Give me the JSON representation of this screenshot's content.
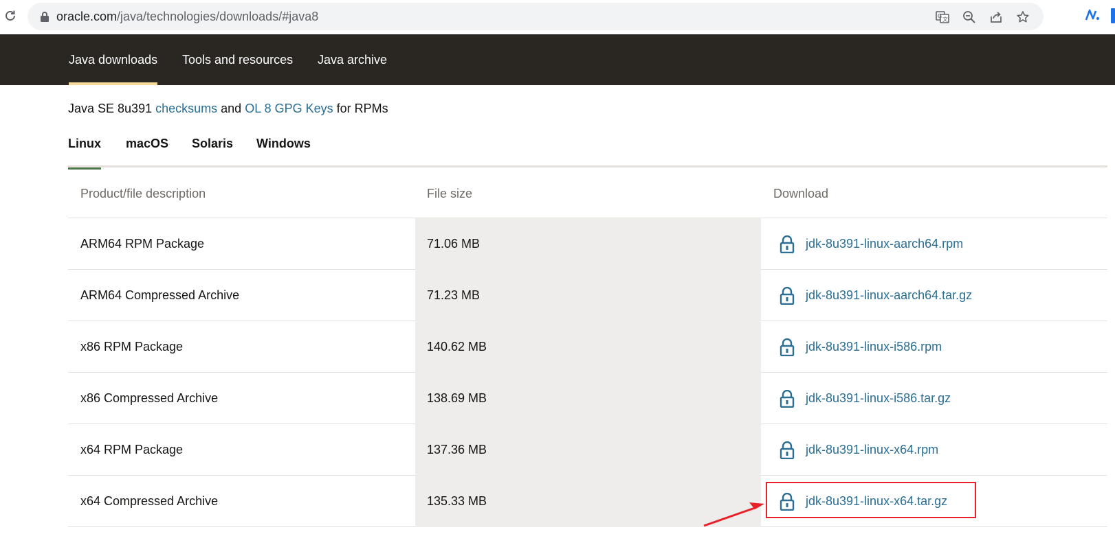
{
  "browser": {
    "url_host": "oracle.com",
    "url_path": "/java/technologies/downloads/#java8",
    "icons": [
      "reload-icon",
      "lock-icon",
      "translate-icon",
      "zoom-out-icon",
      "share-icon",
      "star-icon",
      "extension-icon"
    ]
  },
  "topnav": {
    "items": [
      {
        "label": "Java downloads",
        "active": true
      },
      {
        "label": "Tools and resources",
        "active": false
      },
      {
        "label": "Java archive",
        "active": false
      }
    ]
  },
  "checksums": {
    "prefix": "Java SE 8u391",
    "link1": "checksums",
    "middle": "and",
    "link2": "OL 8 GPG Keys",
    "suffix": "for RPMs"
  },
  "os_tabs": [
    {
      "label": "Linux",
      "active": true
    },
    {
      "label": "macOS",
      "active": false
    },
    {
      "label": "Solaris",
      "active": false
    },
    {
      "label": "Windows",
      "active": false
    }
  ],
  "table": {
    "headers": {
      "description": "Product/file description",
      "size": "File size",
      "download": "Download"
    },
    "rows": [
      {
        "description": "ARM64 RPM Package",
        "size": "71.06 MB",
        "file": "jdk-8u391-linux-aarch64.rpm"
      },
      {
        "description": "ARM64 Compressed Archive",
        "size": "71.23 MB",
        "file": "jdk-8u391-linux-aarch64.tar.gz"
      },
      {
        "description": "x86 RPM Package",
        "size": "140.62 MB",
        "file": "jdk-8u391-linux-i586.rpm"
      },
      {
        "description": "x86 Compressed Archive",
        "size": "138.69 MB",
        "file": "jdk-8u391-linux-i586.tar.gz"
      },
      {
        "description": "x64 RPM Package",
        "size": "137.36 MB",
        "file": "jdk-8u391-linux-x64.rpm"
      },
      {
        "description": "x64 Compressed Archive",
        "size": "135.33 MB",
        "file": "jdk-8u391-linux-x64.tar.gz"
      }
    ]
  },
  "colors": {
    "nav_bg": "#2a2622",
    "active_underline": "#f5d99a",
    "link": "#2a6e94",
    "os_tab_underline": "#4e7a4b",
    "annotation": "#e8202a"
  }
}
